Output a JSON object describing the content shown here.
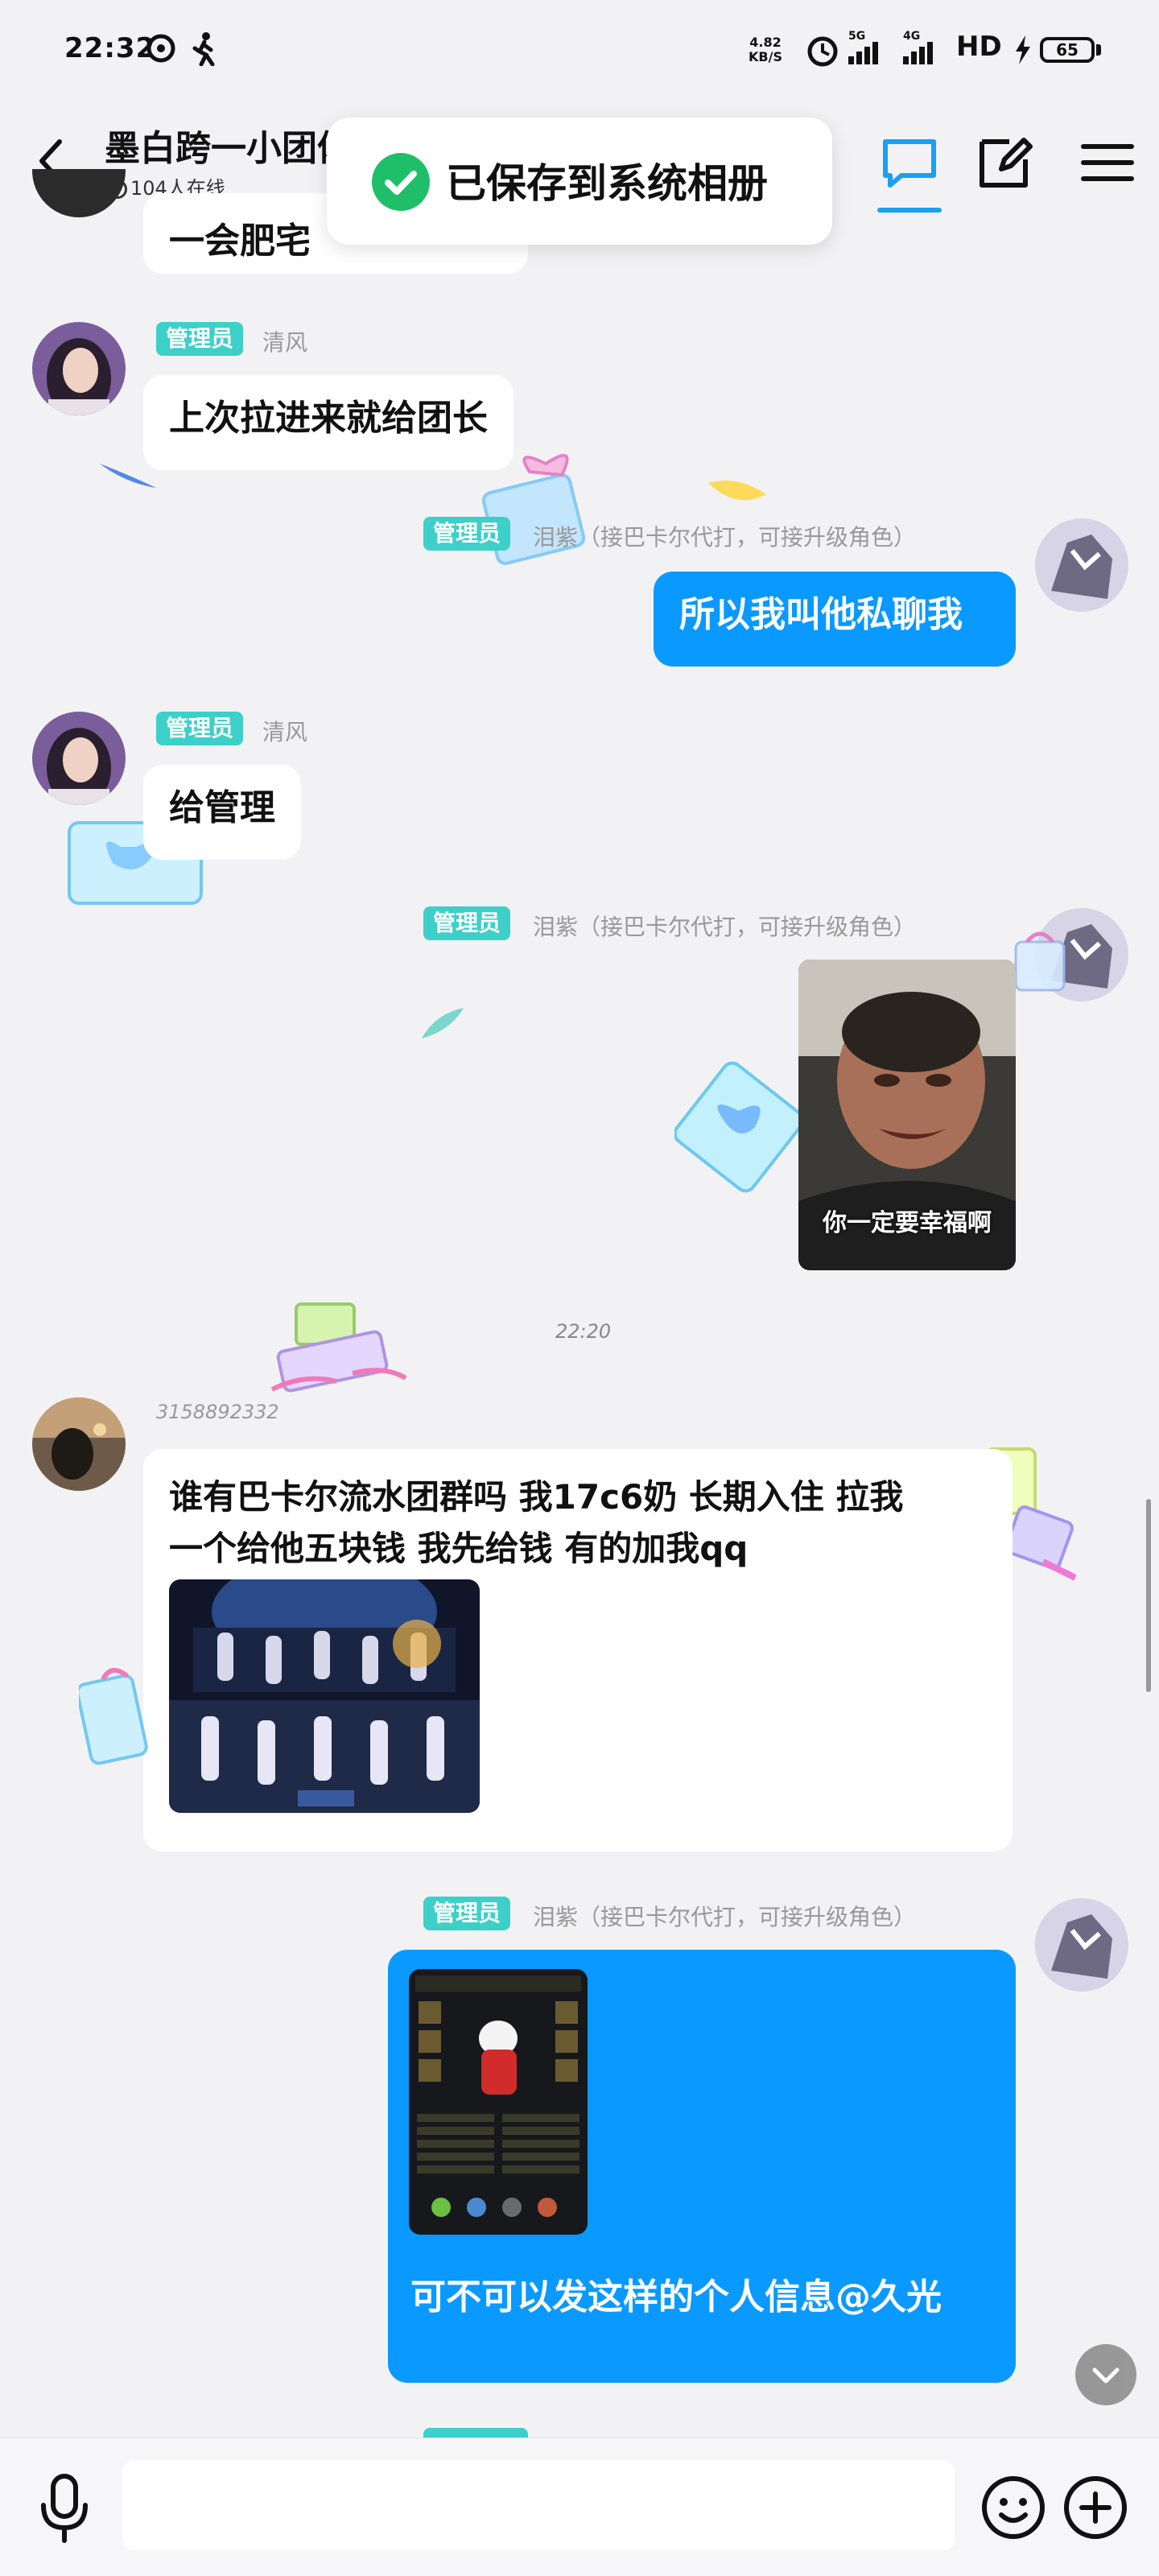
{
  "status_bar": {
    "time": "22:32",
    "net_speed_value": "4.82",
    "net_speed_unit": "KB/S",
    "sim1": "5G",
    "sim2": "4G",
    "hd": "HD",
    "battery": "65"
  },
  "header": {
    "title": "墨白跨一小团体",
    "online": "104人在线"
  },
  "toast": {
    "text": "已保存到系统相册"
  },
  "messages": [
    {
      "partial_text": "一会肥宅"
    },
    {
      "role": "管理员",
      "sender": "清风",
      "text": "上次拉进来就给团长"
    },
    {
      "role": "管理员",
      "sender": "泪紫（接巴卡尔代打，可接升级角色）",
      "text": "所以我叫他私聊我"
    },
    {
      "role": "管理员",
      "sender": "清风",
      "text": "给管理"
    },
    {
      "role": "管理员",
      "sender": "泪紫（接巴卡尔代打，可接升级角色）",
      "image_caption": "你一定要幸福啊"
    },
    {
      "timestamp": "22:20"
    },
    {
      "sender": "3158892332",
      "text_line1": "谁有巴卡尔流水团群吗 我17c6奶 长期入住 拉我",
      "text_line2": "一个给他五块钱 我先给钱 有的加我qq"
    },
    {
      "role": "管理员",
      "sender": "泪紫（接巴卡尔代打，可接升级角色）",
      "text": "可不可以发这样的个人信息@久光"
    }
  ],
  "colors": {
    "accent": "#0a99ff",
    "badge": "#3dd0c8",
    "toast_check": "#1fbf6a",
    "background": "#f2f2f4"
  },
  "icons": {
    "back": "chevron-left-icon",
    "chat": "chat-bubble-icon",
    "edit": "edit-icon",
    "menu": "menu-icon",
    "mic": "microphone-icon",
    "emoji": "smiley-icon",
    "plus": "plus-icon"
  }
}
